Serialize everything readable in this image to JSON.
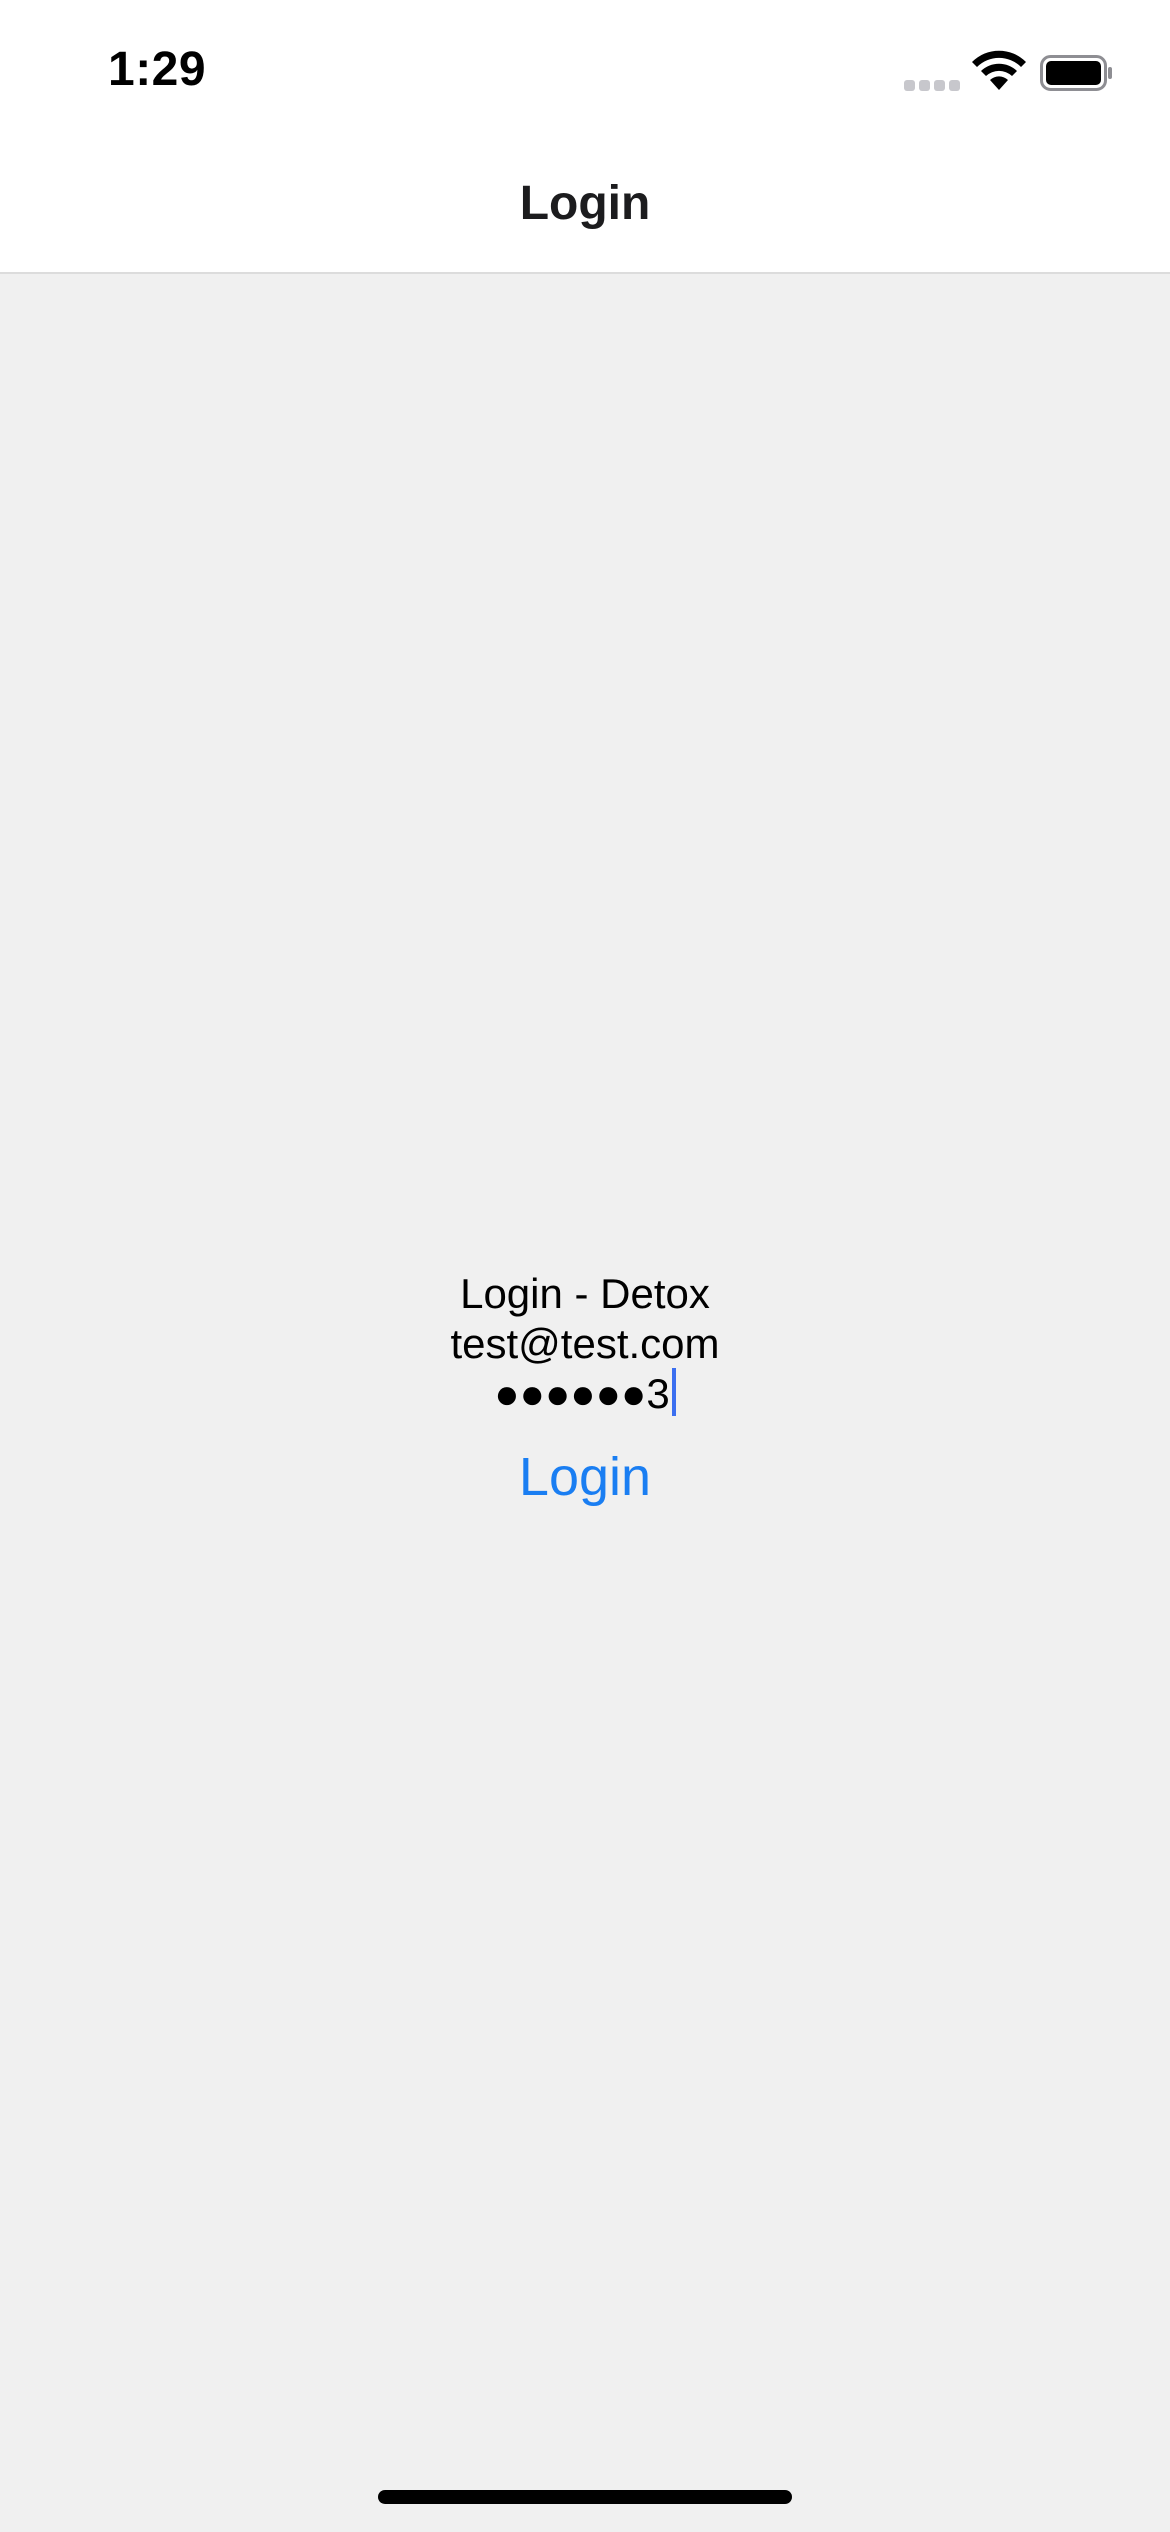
{
  "status_bar": {
    "time": "1:29",
    "icons": [
      "cellular-signal-icon",
      "wifi-icon",
      "battery-icon"
    ]
  },
  "nav": {
    "title": "Login"
  },
  "form": {
    "caption": "Login - Detox",
    "email_value": "test@test.com",
    "password_masked": "●●●●●●",
    "password_last_char": "3",
    "login_button_label": "Login"
  },
  "colors": {
    "accent": "#1a7ef2",
    "cursor": "#3b6ff0",
    "background": "#f0f0f0",
    "bar_background": "#ffffff"
  }
}
